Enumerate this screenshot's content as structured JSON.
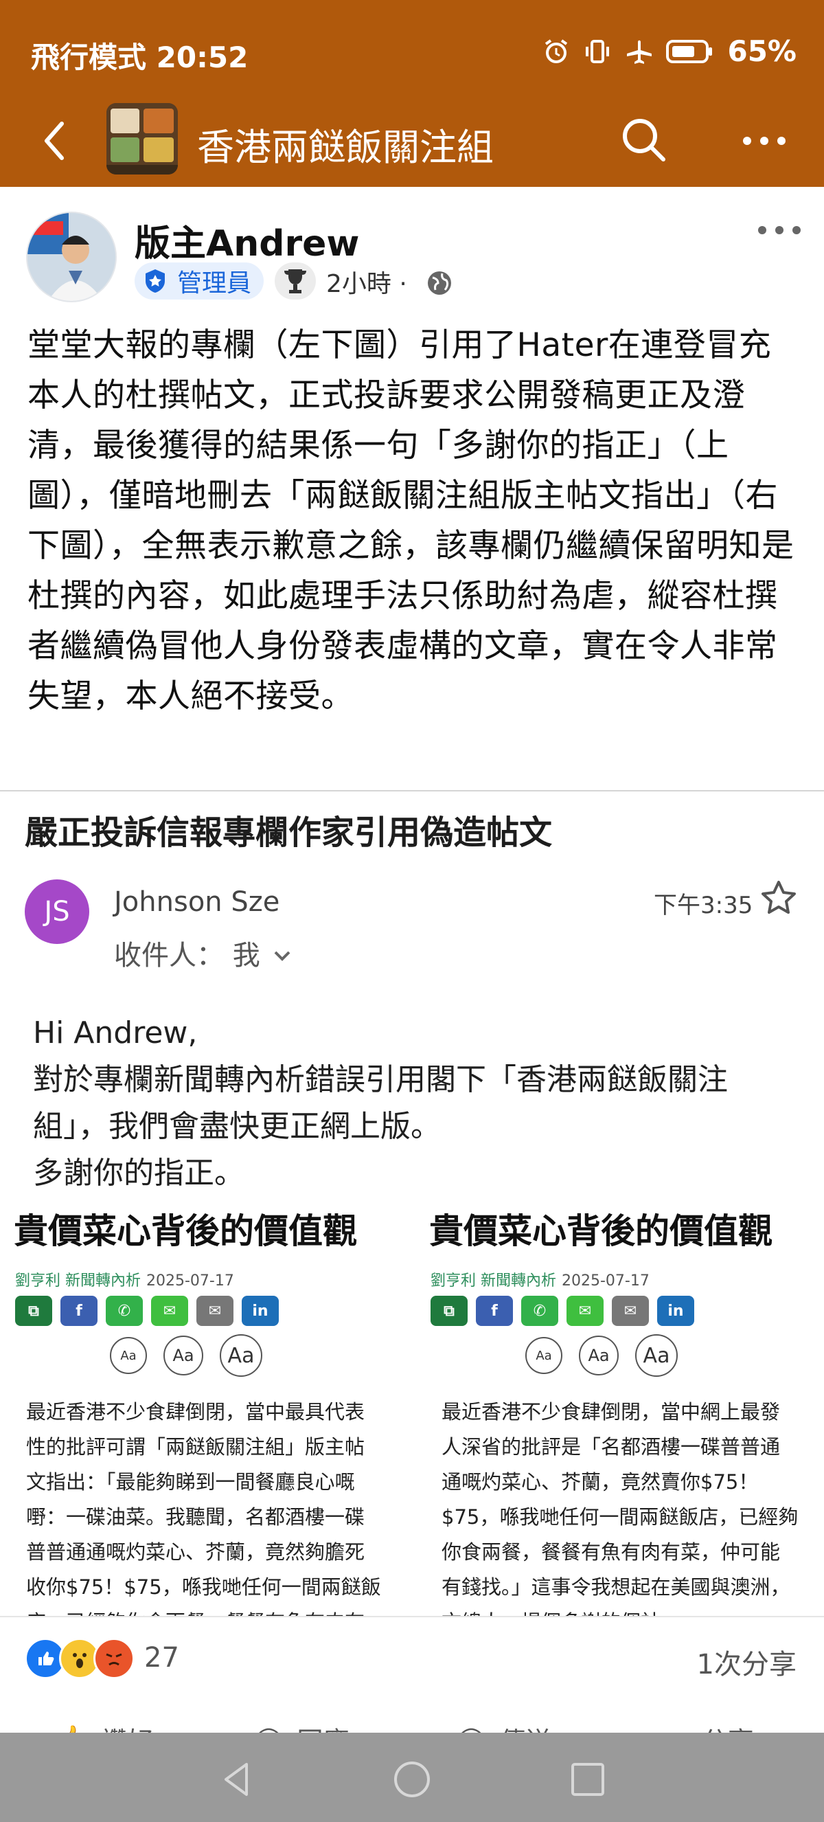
{
  "status_bar": {
    "left_text": "飛行模式 20:52",
    "battery": "65%",
    "icons": [
      "alarm-icon",
      "vibrate-icon",
      "airplane-icon",
      "battery-icon"
    ]
  },
  "header": {
    "title": "香港兩餸飯關注組",
    "icons": [
      "back-icon",
      "search-icon",
      "more-icon"
    ]
  },
  "post": {
    "author": "版主Andrew",
    "role_badge": "管理員",
    "time": "2小時",
    "separator": "·",
    "text": "堂堂大報的專欄（左下圖）引用了Hater在連登冒充本人的杜撰帖文，正式投訴要求公開發稿更正及澄清，最後獲得的結果係一句「多謝你的指正」（上圖），僅暗地刪去「兩餸飯關注組版主帖文指出」（右下圖），全無表示歉意之餘，該專欄仍繼續保留明知是杜撰的內容，如此處理手法只係助紂為虐，縱容杜撰者繼續偽冒他人身份發表虛構的文章，實在令人非常失望，本人絕不接受。"
  },
  "email": {
    "subject": "嚴正投訴信報專欄作家引用偽造帖文",
    "avatar_initials": "JS",
    "sender": "Johnson Sze",
    "to_label": "收件人：",
    "to_value": "我",
    "time": "下午3:35",
    "greeting": "Hi Andrew,",
    "body_line1": "對於專欄新聞轉內析錯誤引用閣下「香港兩餸飯關注組」，我們會盡快更正網上版。",
    "body_line2": "多謝你的指正。"
  },
  "articles": [
    {
      "title": "貴價菜心背後的價值觀",
      "author_column": "劉亨利 新聞轉內析",
      "date": "2025-07-17",
      "font_sizes": [
        "Aa",
        "Aa",
        "Aa"
      ],
      "text": "最近香港不少食肆倒閉，當中最具代表性的批評可謂「兩餸飯關注組」版主帖文指出：「最能夠睇到一間餐廳良心嘅嘢：一碟油菜。我聽聞，名都酒樓一碟普普通通嘅灼菜心、芥蘭，竟然夠膽死收你$75！$75，喺我哋任何一間兩餸飯店，已經夠你食兩餐，餐餐有魚有肉有菜"
    },
    {
      "title": "貴價菜心背後的價值觀",
      "author_column": "劉亨利 新聞轉內析",
      "date": "2025-07-17",
      "font_sizes": [
        "Aa",
        "Aa",
        "Aa"
      ],
      "text": "最近香港不少食肆倒閉，當中網上最發人深省的批評是「名都酒樓一碟普普通通嘅灼菜心、芥蘭，竟然賣你$75！$75，喺我哋任何一間兩餸飯店，已經夠你食兩餐，餐餐有魚有肉有菜，仲可能有錢找。」這事令我想起在美國與澳洲，文總人一場個多謝的個社"
    }
  ],
  "share_icons": [
    "copy-icon",
    "facebook-icon",
    "whatsapp-icon",
    "wechat-icon",
    "email-icon",
    "linkedin-icon"
  ],
  "share_labels": [
    "⧉",
    "f",
    "✆",
    "✉",
    "✉",
    "in"
  ],
  "reactions": {
    "icons": [
      "like-icon",
      "wow-icon",
      "angry-icon"
    ],
    "count": "27",
    "shares": "1次分享"
  },
  "actions": {
    "like": "讚好",
    "comment": "回應",
    "send": "傳送",
    "share": "分享"
  },
  "colors": {
    "header_bg": "#b0590c",
    "admin_badge": "#1b66d9",
    "avatar_js": "#a548c8"
  }
}
